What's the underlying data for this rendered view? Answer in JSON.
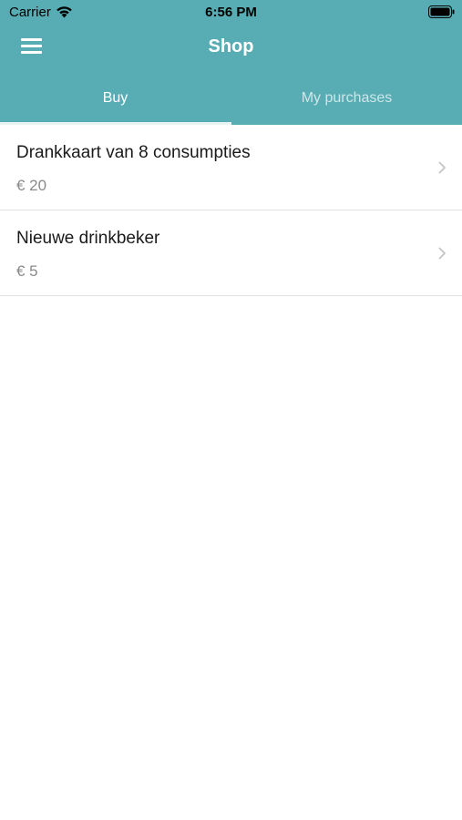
{
  "status_bar": {
    "carrier": "Carrier",
    "time": "6:56 PM"
  },
  "header": {
    "title": "Shop",
    "background_color": "#57adb3"
  },
  "tabs": [
    {
      "label": "Buy",
      "active": true
    },
    {
      "label": "My purchases",
      "active": false
    }
  ],
  "products": [
    {
      "name": "Drankkaart van 8 consumpties",
      "price": "€ 20"
    },
    {
      "name": "Nieuwe drinkbeker",
      "price": "€ 5"
    }
  ]
}
